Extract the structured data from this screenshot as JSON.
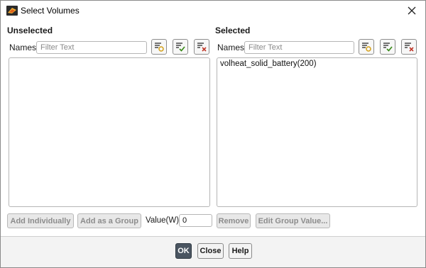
{
  "window": {
    "title": "Select Volumes",
    "close_icon": "close-icon",
    "app_icon": "ansys-fluent-icon"
  },
  "unselected": {
    "title": "Unselected",
    "names_label": "Names",
    "filter_placeholder": "Filter Text",
    "items": []
  },
  "selected": {
    "title": "Selected",
    "names_label": "Names",
    "filter_placeholder": "Filter Text",
    "items": [
      "volheat_solid_battery(200)"
    ]
  },
  "actions": {
    "add_individually": "Add Individually",
    "add_as_group": "Add as a Group",
    "value_label": "Value(W)",
    "value": "0",
    "remove": "Remove",
    "edit_group_value": "Edit Group Value..."
  },
  "footer": {
    "ok": "OK",
    "close": "Close",
    "help": "Help"
  },
  "colors": {
    "ok_button_bg": "#4a5561",
    "check_green": "#3a8a1a",
    "clear_red": "#c0392b",
    "filter_gold": "#d4a017"
  }
}
